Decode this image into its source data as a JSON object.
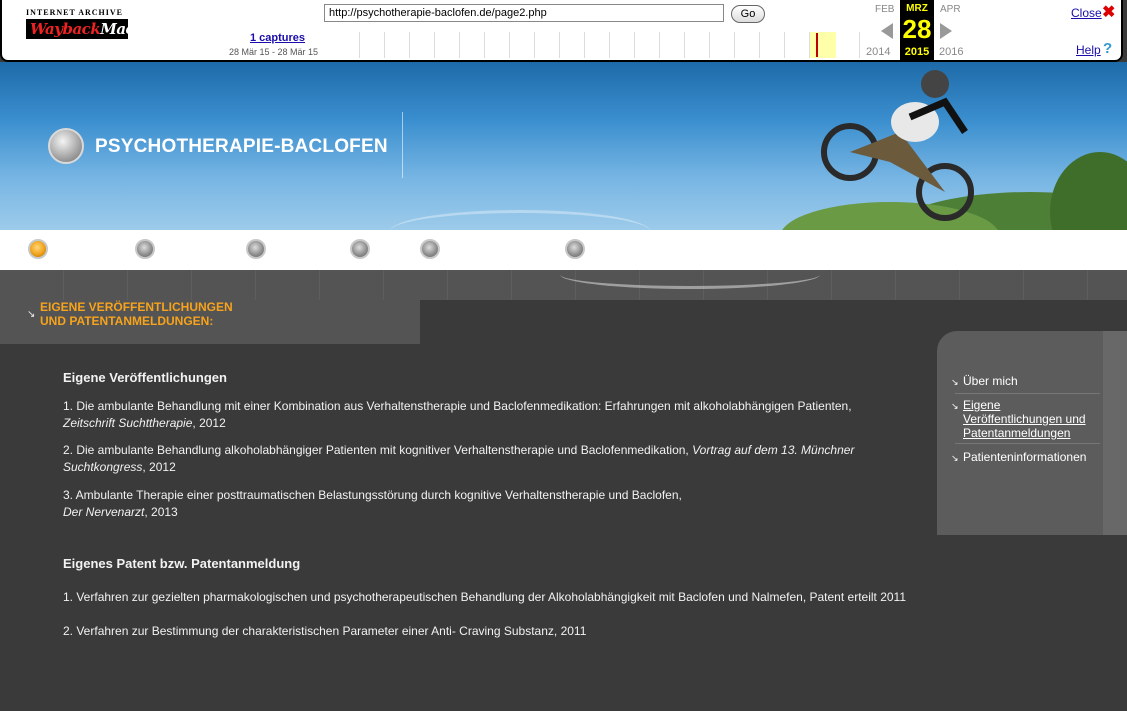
{
  "wayback": {
    "logo_top": "INTERNET ARCHIVE",
    "logo_main_a": "Wayback",
    "logo_main_b": "Machine",
    "url": "http://psychotherapie-baclofen.de/page2.php",
    "go_label": "Go",
    "captures_label": "1 captures",
    "range_label": "28 Mär 15 - 28 Mär 15",
    "prev_month": "FEB",
    "cur_month": "MRZ",
    "next_month": "APR",
    "cur_day": "28",
    "prev_year": "2014",
    "cur_year": "2015",
    "next_year": "2016",
    "close_label": "Close",
    "help_label": "Help",
    "close_icon": "✖",
    "help_icon": "?"
  },
  "header": {
    "site_title": "PSYCHOTHERAPIE-BACLOFEN"
  },
  "section": {
    "heading_line1": "EIGENE VERÖFFENTLICHUNGEN",
    "heading_line2": "UND PATENTANMELDUNGEN:"
  },
  "content": {
    "pub_heading": "Eigene Veröffentlichungen",
    "publications": [
      {
        "text": "1. Die ambulante Behandlung mit einer Kombination aus Verhaltenstherapie und Baclofenmedikation: Erfahrungen mit alkoholabhängigen Patienten,",
        "source": "Zeitschrift Suchttherapie",
        "year": ", 2012"
      },
      {
        "text": "2. Die ambulante Behandlung alkoholabhängiger Patienten mit kognitiver Verhaltenstherapie und Baclofenmedikation,",
        "source": "Vortrag auf dem 13. Münchner Suchtkongress",
        "year": ", 2012"
      },
      {
        "text": "3. Ambulante Therapie einer posttraumatischen Belastungsstörung durch kognitive Verhaltenstherapie und Baclofen,",
        "source": "Der Nervenarzt",
        "year": ", 2013"
      }
    ],
    "patent_heading": "Eigenes Patent  bzw. Patentanmeldung",
    "patents": [
      "1. Verfahren zur gezielten pharmakologischen und psychotherapeutischen Behandlung der Alkoholabhängigkeit mit Baclofen und Nalmefen, Patent erteilt 2011",
      "2. Verfahren zur Bestimmung der charakteristischen Parameter einer Anti- Craving Substanz, 2011"
    ]
  },
  "sidebar": {
    "items": [
      {
        "label": "Über mich"
      },
      {
        "label": "Eigene Veröffentlichungen und Patentanmeldungen"
      },
      {
        "label": "Patienteninformationen"
      }
    ],
    "arrow": "↘"
  },
  "colors": {
    "accent": "#f7a31c",
    "background": "#3a3a3a",
    "wayback_highlight": "#ffff00"
  }
}
